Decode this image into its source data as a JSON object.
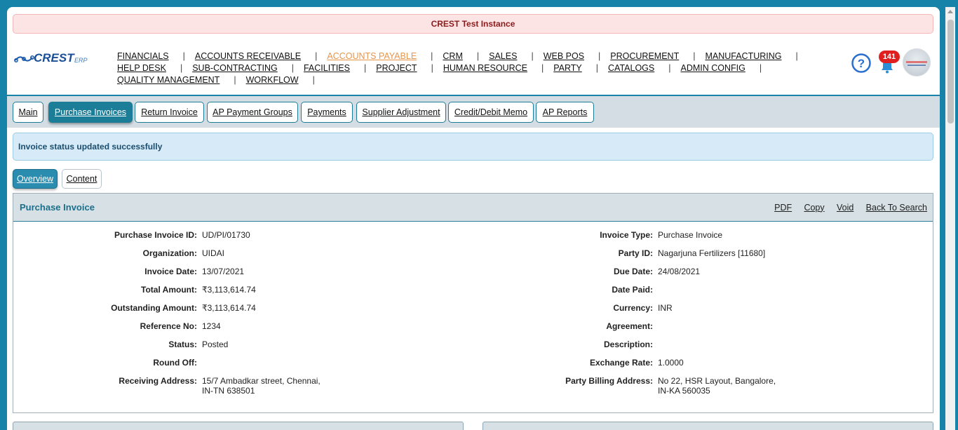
{
  "banner": "CREST Test Instance",
  "logo_text": "CREST ERP",
  "nav": {
    "row1": [
      "FINANCIALS",
      "ACCOUNTS RECEIVABLE",
      "ACCOUNTS PAYABLE",
      "CRM",
      "SALES",
      "WEB POS",
      "PROCUREMENT",
      "MANUFACTURING"
    ],
    "row2": [
      "HELP DESK",
      "SUB-CONTRACTING",
      "FACILITIES",
      "PROJECT",
      "HUMAN RESOURCE",
      "PARTY",
      "CATALOGS",
      "ADMIN CONFIG"
    ],
    "row3": [
      "QUALITY MANAGEMENT",
      "WORKFLOW"
    ],
    "active": "ACCOUNTS PAYABLE"
  },
  "notifications": {
    "count": "141"
  },
  "tabs": [
    "Main",
    "Purchase Invoices",
    "Return Invoice",
    "AP Payment Groups",
    "Payments",
    "Supplier Adjustment",
    "Credit/Debit Memo",
    "AP Reports"
  ],
  "active_tab": "Purchase Invoices",
  "success_message": "Invoice status updated successfully",
  "subtabs": [
    "Overview",
    "Content"
  ],
  "panel": {
    "title": "Purchase Invoice",
    "actions": [
      "PDF",
      "Copy",
      "Void",
      "Back To Search"
    ]
  },
  "left_fields": [
    {
      "label": "Purchase Invoice ID:",
      "value": "UD/PI/01730"
    },
    {
      "label": "Organization:",
      "value": "UIDAI"
    },
    {
      "label": "Invoice Date:",
      "value": "13/07/2021"
    },
    {
      "label": "Total Amount:",
      "value": "₹3,113,614.74"
    },
    {
      "label": "Outstanding Amount:",
      "value": "₹3,113,614.74"
    },
    {
      "label": "Reference No:",
      "value": "1234"
    },
    {
      "label": "Status:",
      "value": "Posted"
    },
    {
      "label": "Round Off:",
      "value": ""
    },
    {
      "label": "Receiving Address:",
      "value": "15/7 Ambadkar street, Chennai,",
      "value2": "IN-TN 638501"
    }
  ],
  "right_fields": [
    {
      "label": "Invoice Type:",
      "value": "Purchase Invoice"
    },
    {
      "label": "Party ID:",
      "value": "Nagarjuna Fertilizers [11680]"
    },
    {
      "label": "Due Date:",
      "value": "24/08/2021"
    },
    {
      "label": "Date Paid:",
      "value": ""
    },
    {
      "label": "Currency:",
      "value": "INR"
    },
    {
      "label": "Agreement:",
      "value": ""
    },
    {
      "label": "Description:",
      "value": ""
    },
    {
      "label": "Exchange Rate:",
      "value": "1.0000"
    },
    {
      "label": "Party Billing Address:",
      "value": "No 22, HSR Layout, Bangalore,",
      "value2": "IN-KA 560035"
    }
  ],
  "colors": {
    "accent": "#1883a8",
    "active_nav": "#e8954a",
    "badge": "#e02020"
  }
}
